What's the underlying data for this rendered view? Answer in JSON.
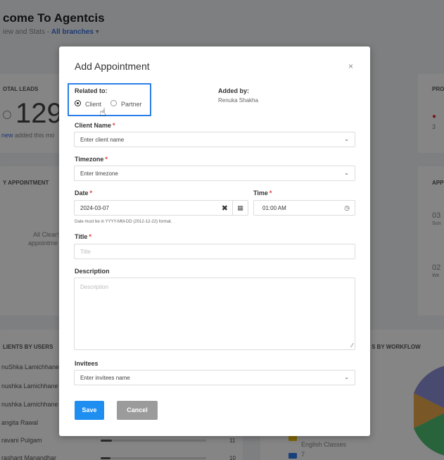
{
  "background": {
    "title": "come To Agentcis",
    "subtitle_prefix": "iew and Stats - ",
    "subtitle_link": "All branches",
    "subtitle_caret": "▾",
    "total_leads_header": "OTAL LEADS",
    "total_leads_value": "129",
    "total_leads_note_link": "new",
    "total_leads_note": " added this mo",
    "right_card_header": "PRO",
    "right_card_value": "3",
    "my_appointment_header": "Y APPOINTMENT",
    "all_clear_line1": "All Clear!",
    "all_clear_line2": "appointme",
    "appt_header": "APP",
    "appt_1_value": "03",
    "appt_1_label": "Sun",
    "appt_2_value": "02",
    "appt_2_label": "We",
    "clients_by_users_header": "LIENTS BY USERS",
    "workflow_header": "S BY WORKFLOW",
    "users": [
      {
        "name": "nuShka Lamichhane",
        "count": ""
      },
      {
        "name": "nushka Lamichhane",
        "count": ""
      },
      {
        "name": "nushka Lamichhane",
        "count": ""
      },
      {
        "name": "angita Rawal",
        "count": ""
      },
      {
        "name": "ravani Pulgam",
        "count": "11"
      },
      {
        "name": "rashant Manandhar",
        "count": "10"
      }
    ],
    "legend_item": "English Classes",
    "legend_num": "7"
  },
  "modal": {
    "title": "Add Appointment",
    "close": "×",
    "related_label": "Related to:",
    "radio_client": "Client",
    "radio_partner": "Partner",
    "added_by_label": "Added by:",
    "added_by_value": "Renuka Shakha",
    "client_name_label": "Client Name",
    "client_name_placeholder": "Enter client name",
    "timezone_label": "Timezone",
    "timezone_placeholder": "Enter timezone",
    "date_label": "Date",
    "date_value": "2024-03-07",
    "date_hint": "Date must be in YYYY-MM-DD (2012-12-22) format.",
    "time_label": "Time",
    "time_value": "01:00 AM",
    "title_label": "Title",
    "title_placeholder": "Title",
    "description_label": "Description",
    "description_placeholder": "Description",
    "invitees_label": "Invitees",
    "invitees_placeholder": "Enter invitees name",
    "required_mark": "*",
    "save_label": "Save",
    "cancel_label": "Cancel"
  },
  "colors": {
    "primary": "#1e8ef0",
    "focus": "#2b7de9",
    "required": "#e0322f",
    "cancel": "#9b9b9b"
  }
}
